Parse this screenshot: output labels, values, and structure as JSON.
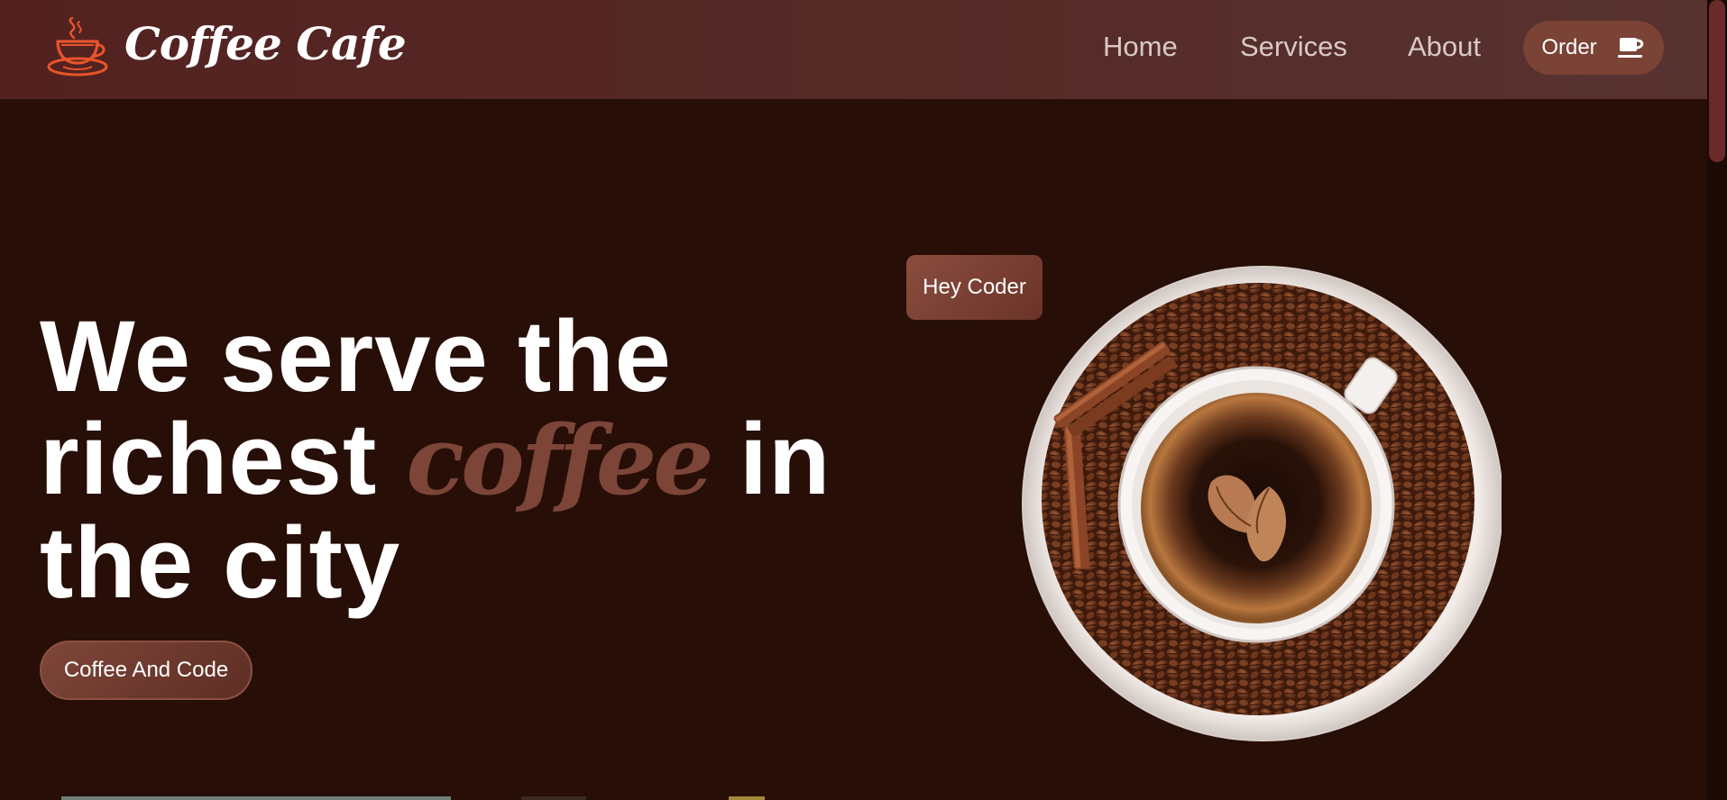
{
  "brand": {
    "name": "Coffee Cafe",
    "logo_icon": "coffee-cup-logo-icon",
    "logo_color": "#e8552a"
  },
  "nav": {
    "links": [
      {
        "label": "Home"
      },
      {
        "label": "Services"
      },
      {
        "label": "About"
      }
    ],
    "order": {
      "label": "Order",
      "icon": "coffee-mug-icon"
    }
  },
  "hero": {
    "title_line1": "We serve the",
    "title_line2_before": "richest",
    "title_accent": "coffee",
    "title_line2_after": "in",
    "title_line3": "the city",
    "cta_label": "Coffee And Code",
    "badge_label": "Hey Coder",
    "image_icon": "coffee-cup-with-beans-image"
  },
  "colors": {
    "background": "#270e06",
    "navbar": "#552a27",
    "accent": "#7c4538",
    "button": "#7a4335",
    "nav_text": "#d9c9c6"
  }
}
